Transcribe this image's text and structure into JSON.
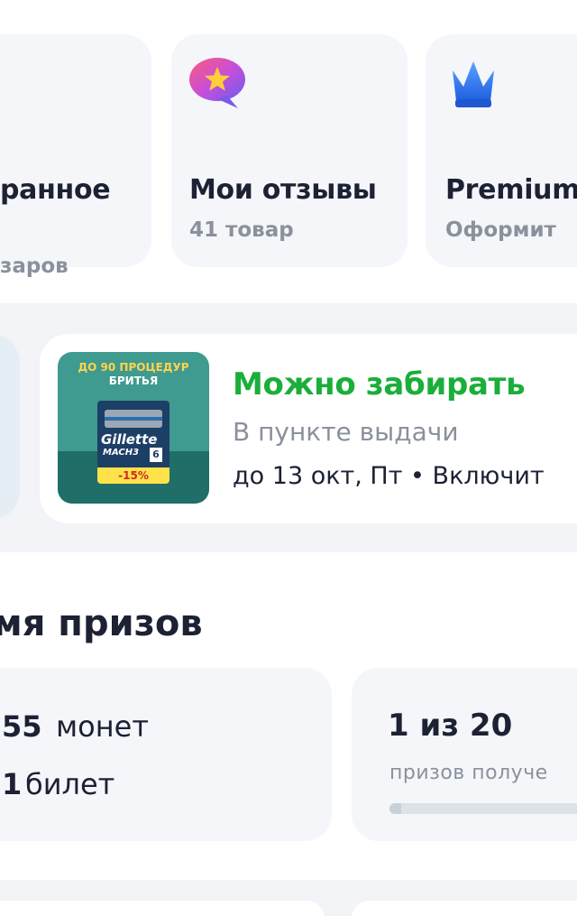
{
  "shortcuts": [
    {
      "title": "ранное",
      "subtitle": "заров",
      "icon": "heart-icon"
    },
    {
      "title": "Мои отзывы",
      "subtitle": "41 товар",
      "icon": "review-star-bubble-icon"
    },
    {
      "title": "Premium",
      "subtitle": "Оформит",
      "icon": "crown-icon"
    }
  ],
  "order": {
    "status": "Можно забирать",
    "location": "В пункте выдачи",
    "deadline": "до 13 окт, Пт • Включит",
    "status_color": "#1aae3a",
    "product": {
      "promo_line1": "ДО 90 ПРОЦЕДУР",
      "promo_line2": "БРИТЬЯ",
      "brand": "Gillette",
      "model": "MACH3",
      "count": "6",
      "discount": "-15%"
    }
  },
  "prizes": {
    "section_title": "мя призов",
    "coins_value": "55",
    "coins_label": "монет",
    "tickets_value": "1",
    "tickets_label": "билет",
    "progress_text": "1 из 20",
    "progress_label": "призов получе",
    "progress_fraction": 0.05
  }
}
